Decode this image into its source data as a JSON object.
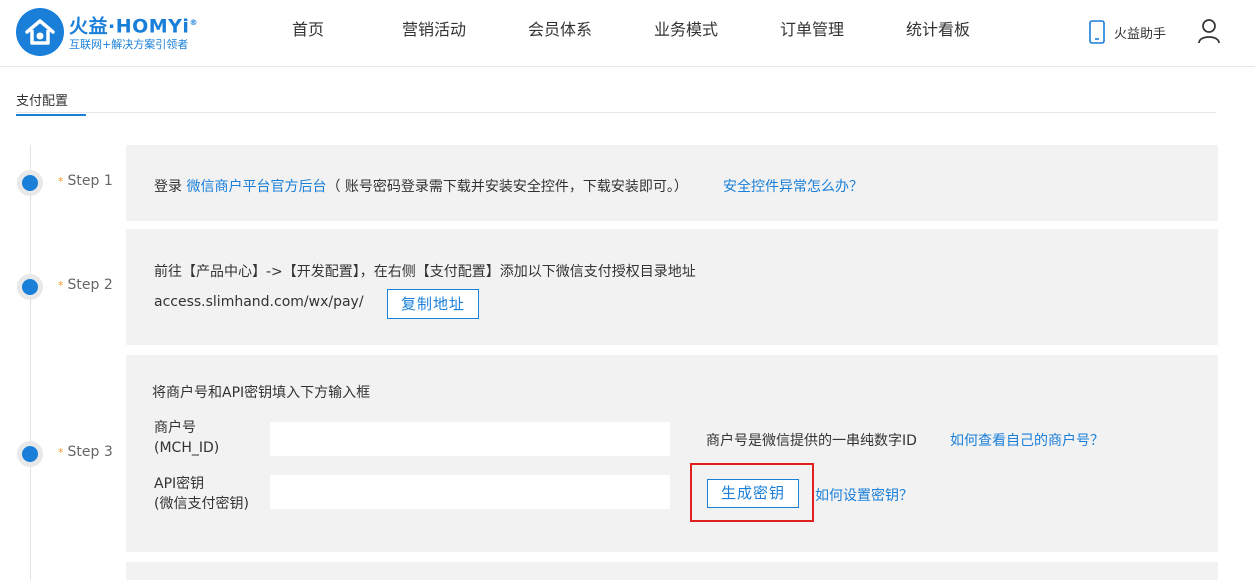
{
  "brand": {
    "title": "火益·HOMYi",
    "trademark": "®",
    "subtitle": "互联网+解决方案引领者"
  },
  "nav": [
    {
      "label": "首页"
    },
    {
      "label": "营销活动"
    },
    {
      "label": "会员体系"
    },
    {
      "label": "业务模式"
    },
    {
      "label": "订单管理"
    },
    {
      "label": "统计看板"
    }
  ],
  "header": {
    "assistant_label": "火益助手"
  },
  "section": {
    "title": "支付配置"
  },
  "steps": {
    "step1": {
      "label": "Step 1",
      "text_prefix": "登录 ",
      "link_platform": "微信商户平台官方后台",
      "text_note": "（ 账号密码登录需下载并安装安全控件，下载安装即可。）",
      "link_help": "安全控件异常怎么办？"
    },
    "step2": {
      "label": "Step 2",
      "instruction": "前往【产品中心】->【开发配置】，在右侧【支付配置】添加以下微信支付授权目录地址",
      "url": "access.slimhand.com/wx/pay/",
      "copy_button": "复制地址"
    },
    "step3": {
      "label": "Step 3",
      "instruction": "将商户号和API密钥填入下方输入框",
      "mch_label_line1": "商户号",
      "mch_label_line2": "(MCH_ID)",
      "mch_value": "",
      "mch_hint": "商户号是微信提供的一串纯数字ID",
      "mch_help_link": "如何查看自己的商户号？",
      "api_label_line1": "API密钥",
      "api_label_line2": "(微信支付密钥)",
      "api_value": "",
      "generate_button": "生成密钥",
      "api_help_link": "如何设置密钥？"
    }
  },
  "colors": {
    "accent": "#1a7fd9",
    "panel_bg": "#f2f2f2",
    "star": "#f39b2b",
    "highlight": "#e02020"
  }
}
